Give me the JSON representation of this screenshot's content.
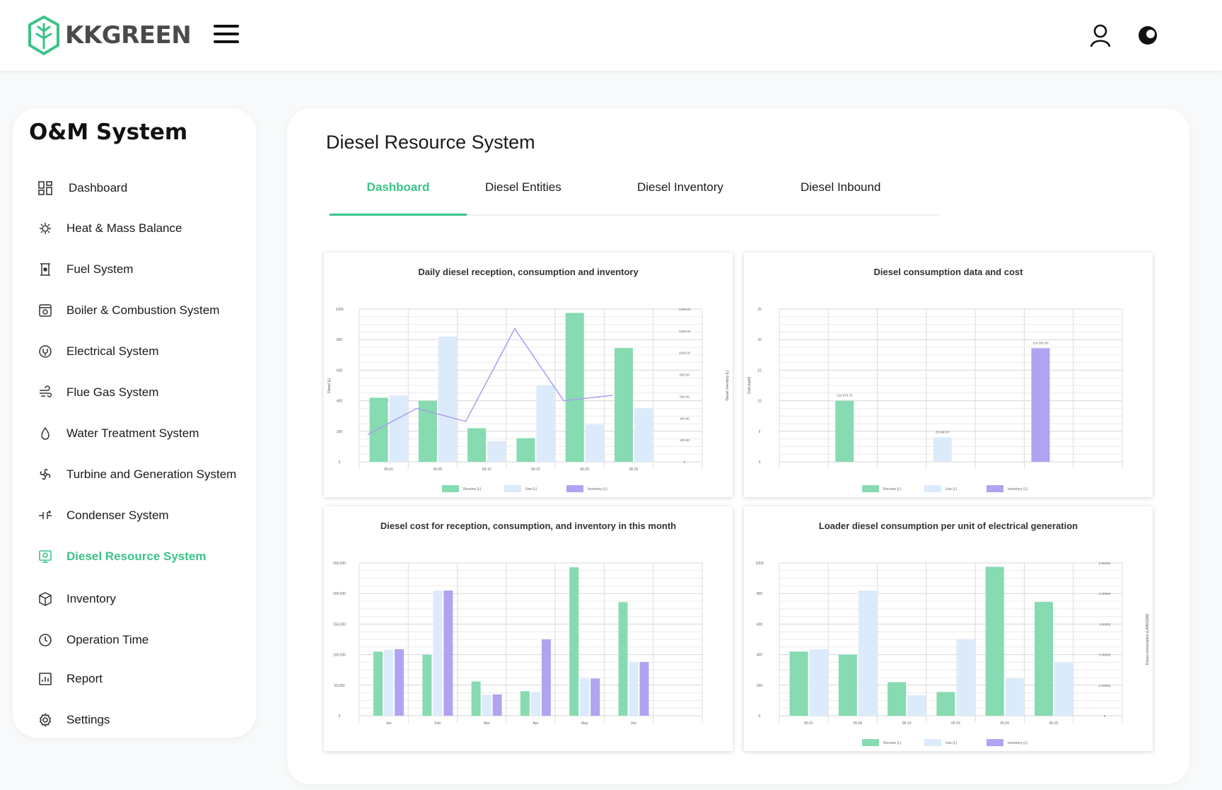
{
  "header": {
    "brand": "KKGREEN",
    "icons": {
      "menu": "hamburger-menu-icon",
      "user": "user-icon",
      "theme": "theme-toggle-icon"
    }
  },
  "sidebar": {
    "title": "O&M System",
    "items": [
      {
        "label": "Dashboard",
        "icon": "grid-icon"
      },
      {
        "label": "Heat & Mass Balance",
        "icon": "gear-balance-icon"
      },
      {
        "label": "Fuel System",
        "icon": "fuel-icon"
      },
      {
        "label": "Boiler & Combustion System",
        "icon": "boiler-icon"
      },
      {
        "label": "Electrical System",
        "icon": "electrical-icon"
      },
      {
        "label": "Flue Gas System",
        "icon": "wind-icon"
      },
      {
        "label": "Water Treatment System",
        "icon": "water-drop-icon"
      },
      {
        "label": "Turbine and Generation System",
        "icon": "turbine-icon"
      },
      {
        "label": "Condenser System",
        "icon": "condenser-icon"
      },
      {
        "label": "Diesel Resource System",
        "icon": "diesel-icon",
        "active": true
      },
      {
        "label": "Inventory",
        "icon": "box-icon"
      },
      {
        "label": "Operation Time",
        "icon": "clock-icon"
      },
      {
        "label": "Report",
        "icon": "report-icon"
      },
      {
        "label": "Settings",
        "icon": "settings-icon"
      }
    ]
  },
  "main": {
    "title": "Diesel Resource System",
    "tabs": [
      {
        "label": "Dashboard",
        "active": true
      },
      {
        "label": "Diesel Entities"
      },
      {
        "label": "Diesel Inventory"
      },
      {
        "label": "Diesel Inbound"
      }
    ]
  },
  "colors": {
    "accent": "#3cc387",
    "reception": "#86dbb1",
    "use": "#dbebfb",
    "inventory": "#b1a3f1",
    "line": "#a99bef"
  },
  "chart_data": [
    {
      "type": "bar",
      "title": "Daily diesel reception, consumption and inventory",
      "categories": [
        "06-01",
        "06-05",
        "06-10",
        "06-15",
        "06-20",
        "06-25"
      ],
      "ylabel": "Diesel (L)",
      "y2label": "Diesel inventory (L)",
      "ylim": [
        0,
        1000
      ],
      "yticks": [
        "0",
        "200",
        "400",
        "600",
        "800",
        "1000"
      ],
      "y2lim": [
        0,
        1400
      ],
      "y2ticks": [
        "0",
        "200.00",
        "400.00",
        "600.00",
        "800.00",
        "1000.00",
        "1200.00",
        "1400.00"
      ],
      "series": [
        {
          "name": "Receive (L)",
          "values": [
            420,
            400,
            220,
            155,
            975,
            745
          ]
        },
        {
          "name": "Use (L)",
          "values": [
            435,
            820,
            135,
            500,
            245,
            350
          ]
        },
        {
          "name": "Inventory (L)",
          "kind": "line",
          "axis": "y2",
          "values": [
            250,
            490,
            370,
            1220,
            560,
            610
          ]
        }
      ]
    },
    {
      "type": "bar",
      "title": "Diesel consumption data and cost",
      "ylabel": "Cost (baht)",
      "ylim": [
        0,
        25
      ],
      "yticks": [
        "0",
        "5",
        "10",
        "15",
        "20",
        "25"
      ],
      "slots": 7,
      "bars": [
        {
          "series": "Receive (L)",
          "slot": 1,
          "value": 10,
          "label": "124,876.76"
        },
        {
          "series": "Use (L)",
          "slot": 3,
          "value": 4,
          "label": "25,990.87"
        },
        {
          "series": "Inventory (L)",
          "slot": 5,
          "value": 18.6,
          "label": "124,382.05"
        }
      ],
      "series": [
        {
          "name": "Receive (L)"
        },
        {
          "name": "Use (L)"
        },
        {
          "name": "Inventory (L)"
        }
      ]
    },
    {
      "type": "bar",
      "title": "Diesel cost for reception, consumption, and inventory in this month",
      "categories": [
        "Jan",
        "Feb",
        "Mar",
        "Apr",
        "May",
        "Jun"
      ],
      "ylim": [
        0,
        250000
      ],
      "yticks": [
        "0",
        "50,000",
        "100,000",
        "150,000",
        "200,000",
        "250,000"
      ],
      "series": [
        {
          "name": "Receive (L)",
          "values": [
            105000,
            100000,
            56000,
            40000,
            243000,
            186000
          ]
        },
        {
          "name": "Use (L)",
          "values": [
            108000,
            205000,
            34000,
            39000,
            61000,
            88000
          ]
        },
        {
          "name": "Inventory (L)",
          "values": [
            109000,
            205000,
            35000,
            125000,
            61000,
            88000
          ]
        }
      ]
    },
    {
      "type": "bar",
      "title": "Loader diesel consumption per unit of electrical generation",
      "categories": [
        "06-01",
        "06-05",
        "06-10",
        "06-15",
        "06-20",
        "06-25"
      ],
      "y2label": "Diesel consumption (L/MWGEN)",
      "ylim": [
        0,
        1000
      ],
      "yticks": [
        "0",
        "200",
        "400",
        "600",
        "800",
        "1000"
      ],
      "y2ticks": [
        "0",
        "2.00000",
        "2.00000",
        "3.00000",
        "4.00000",
        "5.00000"
      ],
      "series": [
        {
          "name": "Receive (L)",
          "values": [
            420,
            400,
            220,
            155,
            975,
            745
          ]
        },
        {
          "name": "Use (L)",
          "values": [
            435,
            820,
            135,
            500,
            245,
            350
          ]
        }
      ],
      "legend": [
        "Receive (L)",
        "Use (L)",
        "Inventory (L)"
      ]
    }
  ]
}
